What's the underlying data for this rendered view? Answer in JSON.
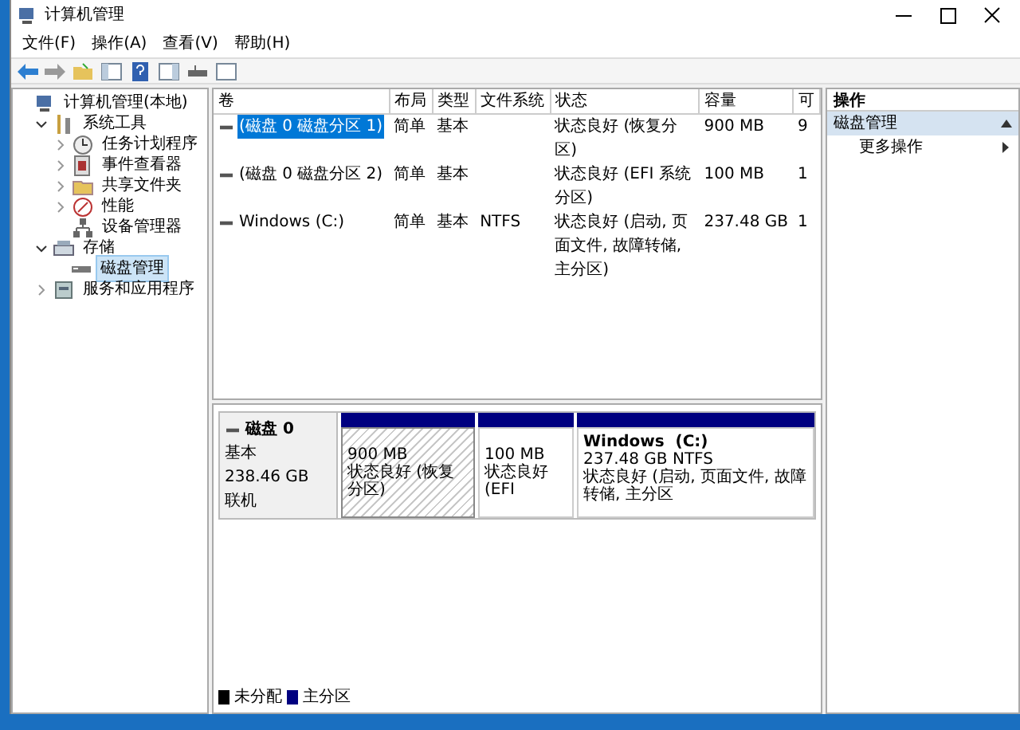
{
  "window": {
    "title": "计算机管理"
  },
  "menu": [
    "文件(F)",
    "操作(A)",
    "查看(V)",
    "帮助(H)"
  ],
  "tree": [
    {
      "label": "计算机管理(本地)",
      "kind": "computer",
      "selected": false,
      "children": [
        {
          "label": "系统工具",
          "kind": "tools",
          "expanded": true,
          "selected": false,
          "children": [
            {
              "label": "任务计划程序",
              "kind": "clock",
              "expanded": false,
              "selected": false
            },
            {
              "label": "事件查看器",
              "kind": "log",
              "expanded": false,
              "selected": false
            },
            {
              "label": "共享文件夹",
              "kind": "folder",
              "expanded": false,
              "selected": false
            },
            {
              "label": "性能",
              "kind": "gauge",
              "expanded": false,
              "selected": false
            },
            {
              "label": "设备管理器",
              "kind": "device",
              "selected": false
            }
          ]
        },
        {
          "label": "存储",
          "kind": "storage",
          "expanded": true,
          "selected": false,
          "children": [
            {
              "label": "磁盘管理",
              "kind": "disk",
              "selected": true
            }
          ]
        },
        {
          "label": "服务和应用程序",
          "kind": "services",
          "expanded": false,
          "selected": false
        }
      ]
    }
  ],
  "table": {
    "columns": [
      "卷",
      "布局",
      "类型",
      "文件系统",
      "状态",
      "容量",
      "可"
    ],
    "rows": [
      {
        "selected": true,
        "cells": [
          "(磁盘 0 磁盘分区 1)",
          "简单",
          "基本",
          "",
          "状态良好 (恢复分区)",
          "900 MB",
          "9"
        ]
      },
      {
        "selected": false,
        "cells": [
          "(磁盘 0 磁盘分区 2)",
          "简单",
          "基本",
          "",
          "状态良好 (EFI 系统分区)",
          "100 MB",
          "1"
        ]
      },
      {
        "selected": false,
        "cells": [
          "Windows (C:)",
          "简单",
          "基本",
          "NTFS",
          "状态良好 (启动, 页面文件, 故障转储, 主分区)",
          "237.48 GB",
          "1"
        ]
      }
    ]
  },
  "disk": {
    "name": "磁盘 0",
    "type": "基本",
    "size": "238.46 GB",
    "status": "联机",
    "partitions": [
      {
        "size": "900 MB",
        "status": "状态良好 (恢复分区)",
        "selected": true
      },
      {
        "size": "100 MB",
        "status": "状态良好 (EFI",
        "selected": false
      },
      {
        "title": "Windows  (C:)",
        "size": "237.48 GB NTFS",
        "status": "状态良好 (启动, 页面文件, 故障转储, 主分区",
        "selected": false
      }
    ]
  },
  "legend": [
    {
      "label": "未分配",
      "color": "#000000"
    },
    {
      "label": "主分区",
      "color": "#000080"
    }
  ],
  "actions": {
    "title": "操作",
    "section": {
      "label": "磁盘管理",
      "expanded": true
    },
    "items": [
      "更多操作"
    ]
  }
}
